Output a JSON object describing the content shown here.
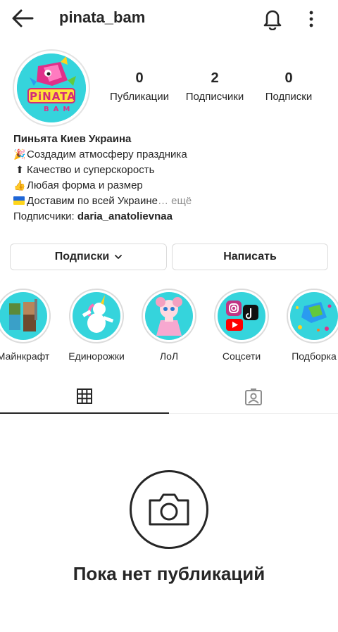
{
  "header": {
    "username": "pinata_bam"
  },
  "profile": {
    "logo_text": "PiNATA",
    "logo_sub": "BAM",
    "stats": {
      "posts": {
        "value": "0",
        "label": "Публикации"
      },
      "followers": {
        "value": "2",
        "label": "Подписчики"
      },
      "following": {
        "value": "0",
        "label": "Подписки"
      }
    },
    "bio": {
      "name": "Пиньята Киев Украина",
      "lines": [
        {
          "icon": "party-popper-icon",
          "text": "Создадим атмосферу праздника"
        },
        {
          "icon": "top-arrow-icon",
          "text": "Качество и суперскорость"
        },
        {
          "icon": "thumbs-up-icon",
          "text": "Любая форма и размер"
        },
        {
          "icon": "ukraine-flag-icon",
          "text": "Доставим по всей Украине"
        }
      ],
      "more": "… ещё",
      "followed_by_label": "Подписчики: ",
      "followed_by_user": "daria_anatolievnaa"
    }
  },
  "buttons": {
    "following": "Подписки",
    "message": "Написать"
  },
  "highlights": [
    {
      "label": "Майнкрафт"
    },
    {
      "label": "Единорожки"
    },
    {
      "label": "ЛоЛ"
    },
    {
      "label": "Соцсети"
    },
    {
      "label": "Подборка"
    }
  ],
  "tabs": {
    "grid_icon": "grid-icon",
    "tagged_icon": "tagged-person-icon"
  },
  "empty_state": {
    "text": "Пока нет публикаций"
  },
  "colors": {
    "accent_cyan": "#35d4dc",
    "text": "#262626",
    "muted": "#8e8e8e",
    "border": "#dbdbdb"
  }
}
